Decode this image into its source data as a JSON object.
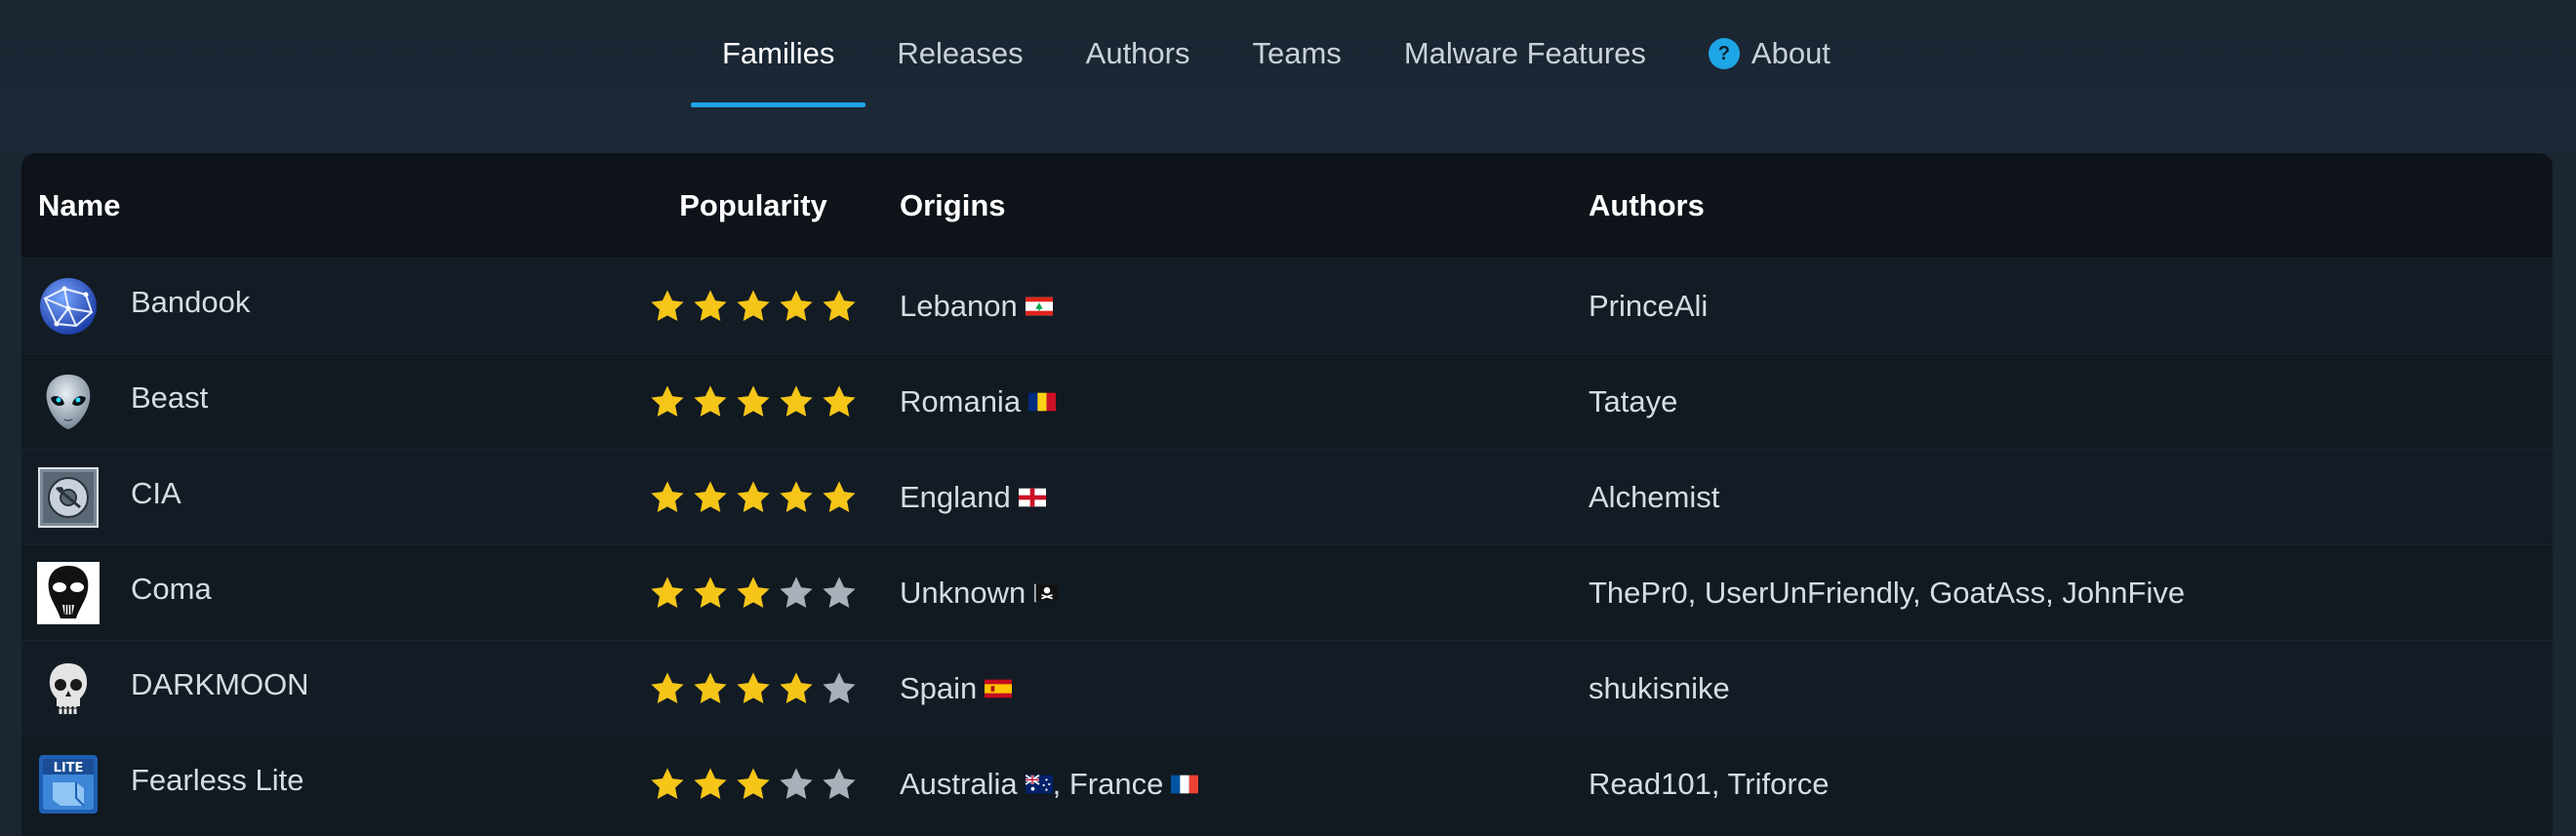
{
  "nav": {
    "tabs": [
      {
        "label": "Families",
        "active": true
      },
      {
        "label": "Releases"
      },
      {
        "label": "Authors"
      },
      {
        "label": "Teams"
      },
      {
        "label": "Malware Features"
      },
      {
        "label": "About",
        "icon": "question-circle-icon"
      }
    ]
  },
  "table": {
    "headers": {
      "name": "Name",
      "popularity": "Popularity",
      "origins": "Origins",
      "authors": "Authors"
    },
    "rows": [
      {
        "name": "Bandook",
        "logo": "globe-icon",
        "stars": 5,
        "origins": [
          {
            "country": "Lebanon",
            "flag": "lebanon-flag-icon"
          }
        ],
        "authors": [
          "PrinceAli"
        ]
      },
      {
        "name": "Beast",
        "logo": "alien-icon",
        "stars": 5,
        "origins": [
          {
            "country": "Romania",
            "flag": "romania-flag-icon"
          }
        ],
        "authors": [
          "Tataye"
        ]
      },
      {
        "name": "CIA",
        "logo": "disc-icon",
        "stars": 5,
        "origins": [
          {
            "country": "England",
            "flag": "england-flag-icon"
          }
        ],
        "authors": [
          "Alchemist"
        ]
      },
      {
        "name": "Coma",
        "logo": "skull-mask-icon",
        "stars": 3,
        "origins": [
          {
            "country": "Unknown",
            "flag": "pirate-flag-icon"
          }
        ],
        "authors": [
          "ThePr0",
          "UserUnFriendly",
          "GoatAss",
          "JohnFive"
        ]
      },
      {
        "name": "DARKMOON",
        "logo": "skull-icon",
        "stars": 4,
        "origins": [
          {
            "country": "Spain",
            "flag": "spain-flag-icon"
          }
        ],
        "authors": [
          "shukisnike"
        ]
      },
      {
        "name": "Fearless Lite",
        "logo": "lite-box-icon",
        "stars": 3,
        "origins": [
          {
            "country": "Australia",
            "flag": "australia-flag-icon"
          },
          {
            "country": "France",
            "flag": "france-flag-icon"
          }
        ],
        "authors": [
          "Read101",
          "Triforce"
        ]
      }
    ]
  },
  "colors": {
    "accent": "#1ea5e6",
    "star_on": "#f5c518",
    "star_off": "#a8b0b9"
  }
}
